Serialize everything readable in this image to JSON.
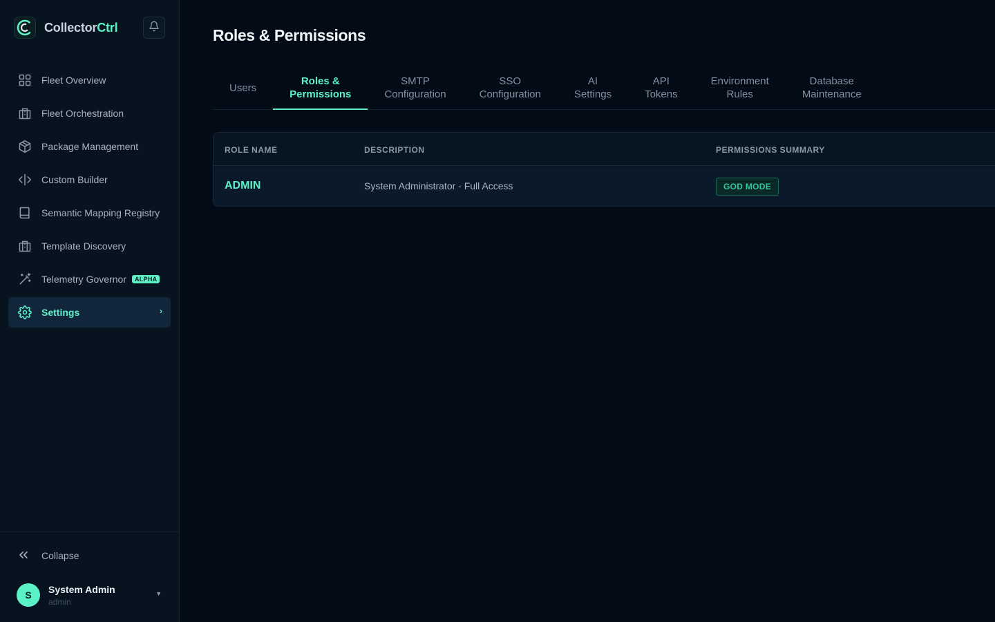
{
  "brand": {
    "name_part1": "Collector",
    "name_part2": "Ctrl",
    "logo_icon": "collectorctrl-logo-icon"
  },
  "header": {
    "notifications_icon": "bell-icon"
  },
  "sidebar": {
    "items": [
      {
        "label": "Fleet Overview",
        "icon": "grid-icon"
      },
      {
        "label": "Fleet Orchestration",
        "icon": "building-icon"
      },
      {
        "label": "Package Management",
        "icon": "package-icon"
      },
      {
        "label": "Custom Builder",
        "icon": "code-icon"
      },
      {
        "label": "Semantic Mapping Registry",
        "icon": "book-icon"
      },
      {
        "label": "Template Discovery",
        "icon": "building-icon"
      },
      {
        "label": "Telemetry Governor",
        "icon": "wand-icon",
        "badge": "ALPHA"
      },
      {
        "label": "Settings",
        "icon": "gear-icon",
        "active": true
      }
    ],
    "collapse_label": "Collapse",
    "user": {
      "initial": "S",
      "name": "System Admin",
      "role": "admin"
    }
  },
  "main": {
    "title": "Roles & Permissions",
    "tabs": [
      {
        "label": "Users"
      },
      {
        "label": "Roles &\nPermissions",
        "active": true
      },
      {
        "label": "SMTP\nConfiguration"
      },
      {
        "label": "SSO\nConfiguration"
      },
      {
        "label": "AI\nSettings"
      },
      {
        "label": "API\nTokens"
      },
      {
        "label": "Environment\nRules"
      },
      {
        "label": "Database\nMaintenance"
      }
    ],
    "table": {
      "columns": [
        "ROLE NAME",
        "DESCRIPTION",
        "PERMISSIONS SUMMARY"
      ],
      "rows": [
        {
          "role": "ADMIN",
          "description": "System Administrator - Full Access",
          "summary_badge": "GOD MODE"
        }
      ]
    }
  },
  "colors": {
    "accent": "#5cf2c8",
    "background": "#020b16",
    "sidebar": "#07131f"
  }
}
